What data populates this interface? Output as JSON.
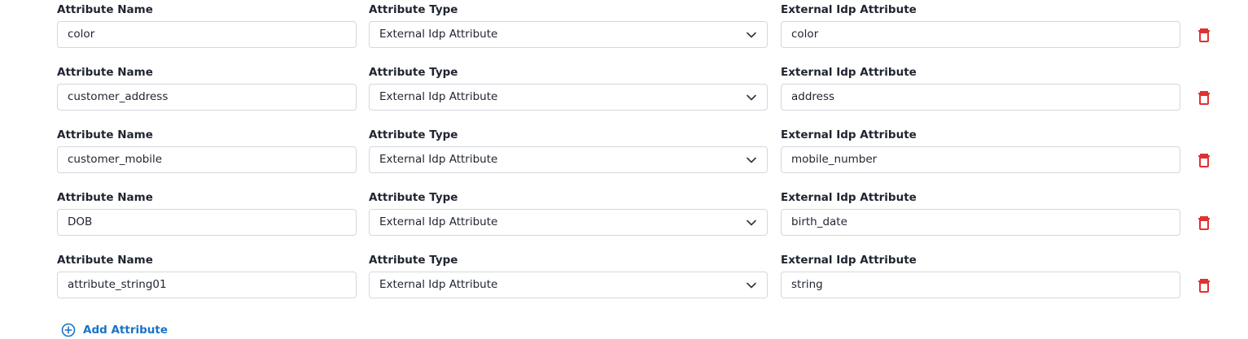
{
  "labels": {
    "attribute_name": "Attribute Name",
    "attribute_type": "Attribute Type",
    "external_idp_attribute": "External Idp Attribute"
  },
  "rows": [
    {
      "name": "color",
      "type": "External Idp Attribute",
      "external": "color"
    },
    {
      "name": "customer_address",
      "type": "External Idp Attribute",
      "external": "address"
    },
    {
      "name": "customer_mobile",
      "type": "External Idp Attribute",
      "external": "mobile_number"
    },
    {
      "name": "DOB",
      "type": "External Idp Attribute",
      "external": "birth_date"
    },
    {
      "name": "attribute_string01",
      "type": "External Idp Attribute",
      "external": "string"
    }
  ],
  "add_attribute_label": "Add Attribute",
  "icons": {
    "delete": "trash-icon",
    "dropdown": "chevron-down-icon",
    "add": "plus-circle-icon"
  },
  "colors": {
    "delete": "#e03131",
    "link": "#1a73c9",
    "border": "#d4d7dd"
  }
}
